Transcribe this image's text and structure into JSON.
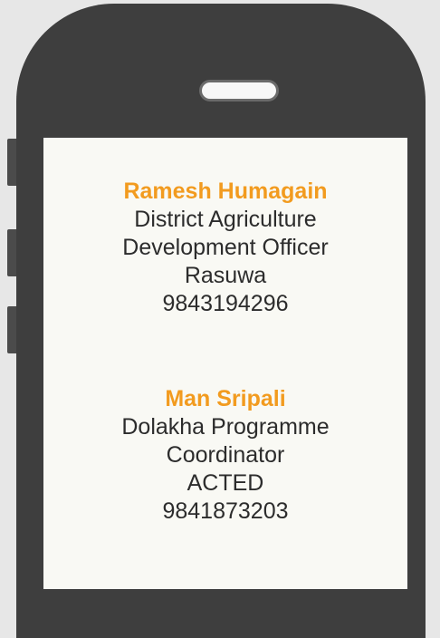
{
  "contacts": [
    {
      "name": "Ramesh Humagain",
      "lines": [
        "District Agriculture",
        "Development Officer",
        "Rasuwa",
        "9843194296"
      ]
    },
    {
      "name": "Man Sripali",
      "lines": [
        "Dolakha Programme",
        "Coordinator",
        "ACTED",
        "9841873203"
      ]
    }
  ],
  "colors": {
    "name_accent": "#f29b1f",
    "phone_body": "#3e3e3e",
    "screen_bg": "#f9f9f4",
    "page_bg": "#e7e7e7"
  }
}
